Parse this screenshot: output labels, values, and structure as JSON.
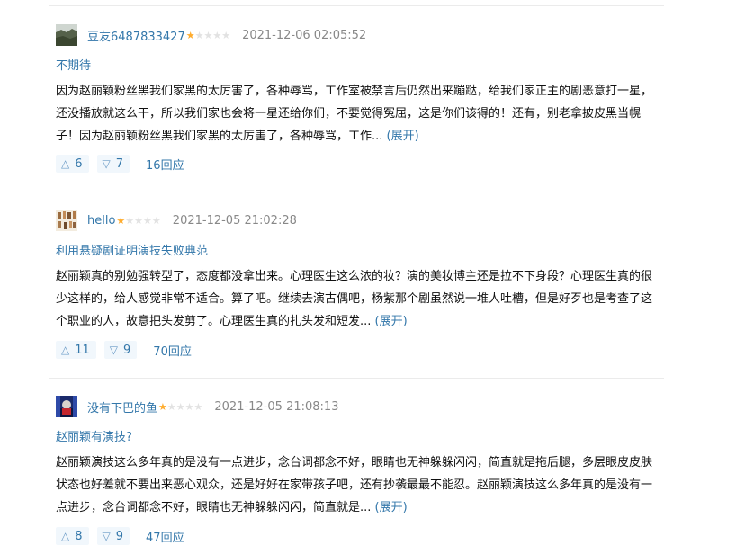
{
  "colors": {
    "link": "#3377aa",
    "star_on": "#ffac2d",
    "star_off": "#e2e2e2",
    "vote_bg": "#f1f7fc",
    "time": "#888888"
  },
  "reviews": [
    {
      "author": "豆友6487833427",
      "rating": 1,
      "rating_max": 5,
      "time": "2021-12-06 02:05:52",
      "title": "不期待",
      "content": "因为赵丽颖粉丝黑我们家黑的太厉害了，各种辱骂，工作室被禁言后仍然出来蹦跶，给我们家正主的剧恶意打一星，还没播放就这么干，所以我们家也会将一星还给你们，不要觉得冤屈，这是你们该得的！还有，别老拿披皮黑当幌子！因为赵丽颖粉丝黑我们家黑的太厉害了，各种辱骂，工作... ",
      "expand_label": "(展开)",
      "useful_count": "6",
      "useless_count": "7",
      "reply_label": "16回应",
      "up_icon": "triangle-up-icon",
      "down_icon": "triangle-down-icon"
    },
    {
      "author": "hello",
      "rating": 1,
      "rating_max": 5,
      "time": "2021-12-05 21:02:28",
      "title": "利用悬疑剧证明演技失败典范",
      "content": "赵丽颖真的别勉强转型了，态度都没拿出来。心理医生这么浓的妆？演的美妆博主还是拉不下身段？心理医生真的很少这样的，给人感觉非常不适合。算了吧。继续去演古偶吧，杨紫那个剧虽然说一堆人吐槽，但是好歹也是考查了这个职业的人，故意把头发剪了。心理医生真的扎头发和短发... ",
      "expand_label": "(展开)",
      "useful_count": "11",
      "useless_count": "9",
      "reply_label": "70回应",
      "up_icon": "triangle-up-icon",
      "down_icon": "triangle-down-icon"
    },
    {
      "author": "没有下巴的鱼",
      "rating": 1,
      "rating_max": 5,
      "time": "2021-12-05 21:08:13",
      "title": "赵丽颖有演技?",
      "content": "赵丽颖演技这么多年真的是没有一点进步，念台词都念不好，眼睛也无神躲躲闪闪，简直就是拖后腿，多层眼皮皮肤状态也好差就不要出来恶心观众，还是好好在家带孩子吧，还有抄袭最最不能忍。赵丽颖演技这么多年真的是没有一点进步，念台词都念不好，眼睛也无神躲躲闪闪，简直就是... ",
      "expand_label": "(展开)",
      "useful_count": "8",
      "useless_count": "9",
      "reply_label": "47回应",
      "up_icon": "triangle-up-icon",
      "down_icon": "triangle-down-icon"
    }
  ]
}
